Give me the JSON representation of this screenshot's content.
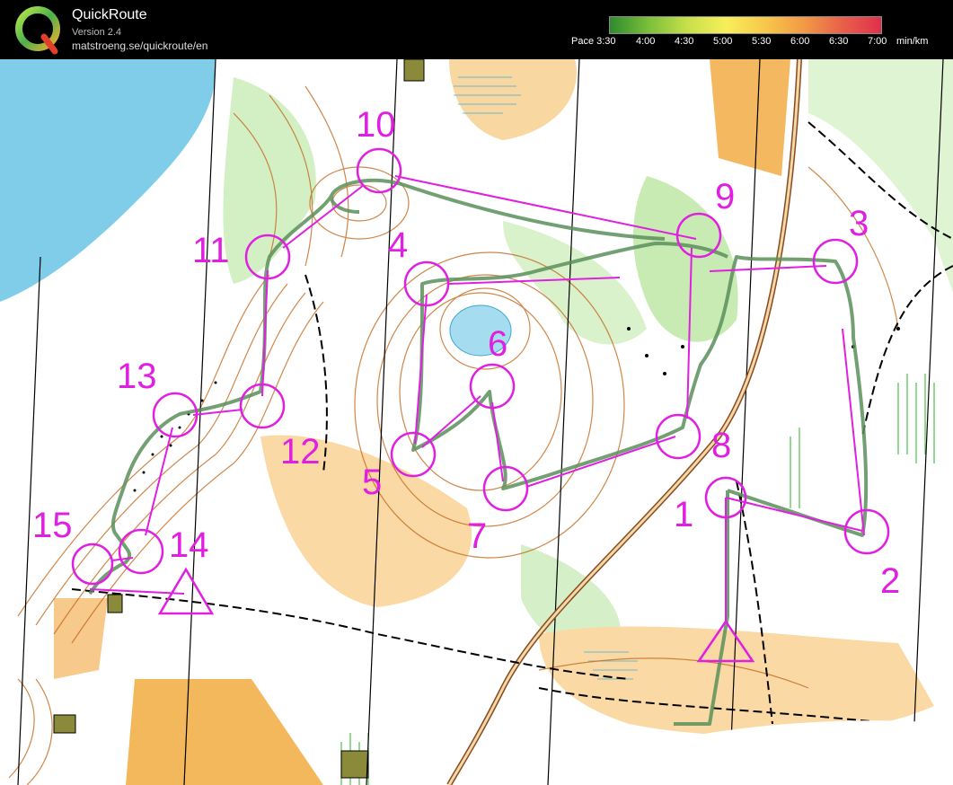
{
  "app": {
    "name": "QuickRoute",
    "version": "Version 2.4",
    "url": "matstroeng.se/quickroute/en",
    "logo_letter": "Q"
  },
  "pace_legend": {
    "prefix": "Pace",
    "unit": "min/km",
    "labels": [
      "3:30",
      "4:00",
      "4:30",
      "5:00",
      "5:30",
      "6:00",
      "6:30",
      "7:00"
    ],
    "colors": [
      "#2e8b2e",
      "#7bbf3a",
      "#c7e04a",
      "#f7ef5a",
      "#f7c84a",
      "#f29a45",
      "#e8604a",
      "#e0304a"
    ]
  },
  "map": {
    "course_color": "#e020e0",
    "route_color": "#5a8f5a",
    "controls": [
      {
        "label": "1"
      },
      {
        "label": "2"
      },
      {
        "label": "3"
      },
      {
        "label": "4"
      },
      {
        "label": "5"
      },
      {
        "label": "6"
      },
      {
        "label": "7"
      },
      {
        "label": "8"
      },
      {
        "label": "9"
      },
      {
        "label": "10"
      },
      {
        "label": "11"
      },
      {
        "label": "12"
      },
      {
        "label": "13"
      },
      {
        "label": "14"
      },
      {
        "label": "15"
      }
    ]
  }
}
